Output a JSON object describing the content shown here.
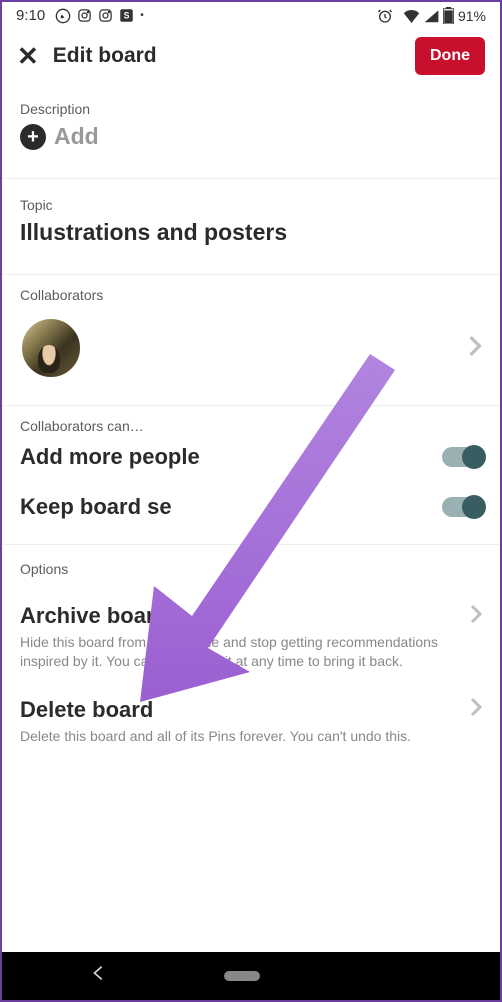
{
  "statusBar": {
    "time": "9:10",
    "battery": "91%"
  },
  "header": {
    "title": "Edit board",
    "doneLabel": "Done"
  },
  "description": {
    "label": "Description",
    "addLabel": "Add"
  },
  "topic": {
    "label": "Topic",
    "value": "Illustrations and posters"
  },
  "collaborators": {
    "label": "Collaborators"
  },
  "collabCan": {
    "label": "Collaborators can…",
    "toggles": [
      {
        "label": "Add more people"
      },
      {
        "label": "Keep board se"
      }
    ]
  },
  "options": {
    "label": "Options",
    "items": [
      {
        "title": "Archive board",
        "sub": "Hide this board from your profile and stop getting recommendations inspired by it. You can unarchive it at any time to bring it back."
      },
      {
        "title": "Delete board",
        "sub": "Delete this board and all of its Pins forever. You can't undo this."
      }
    ]
  },
  "colors": {
    "arrow": "#a06fd8",
    "doneBtn": "#c8102e"
  }
}
